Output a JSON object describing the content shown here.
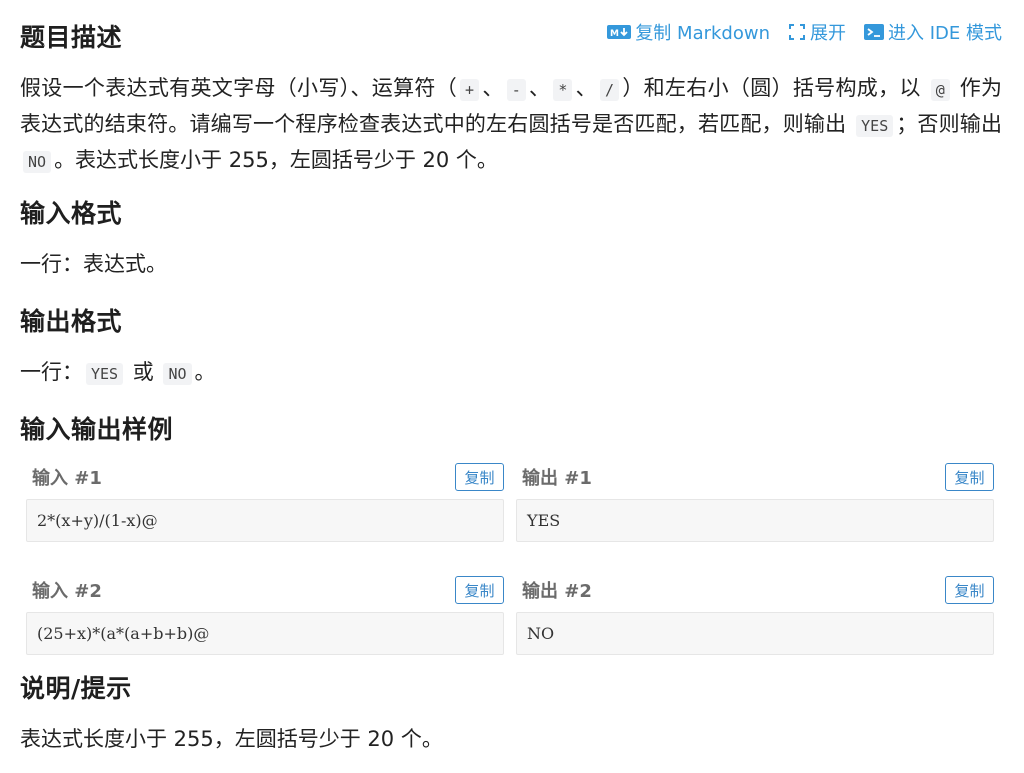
{
  "title": "题目描述",
  "toolbar": {
    "copy_markdown": "复制 Markdown",
    "expand": "展开",
    "ide_mode": "进入 IDE 模式"
  },
  "description": {
    "p1_a": "假设一个表达式有英文字母（小写）、运算符（",
    "op_plus": "+",
    "sep1": "、",
    "op_minus": "-",
    "sep2": "、",
    "op_mul": "*",
    "sep3": "、",
    "op_div": "/",
    "p1_b": "）和左右小（圆）括号构成，以",
    "at": "@",
    "p1_c": "作为表达式的结束符。请编写一个程序检查表达式中的左右圆括号是否匹配，若匹配，则输出",
    "yes": "YES",
    "p1_d": "；否则输出",
    "no": "NO",
    "p1_e": "。表达式长度小于 255，左圆括号少于 20 个。"
  },
  "input_format": {
    "heading": "输入格式",
    "text": "一行：表达式。"
  },
  "output_format": {
    "heading": "输出格式",
    "text_a": "一行：",
    "yes": "YES",
    "or": "或",
    "no": "NO",
    "end": "。"
  },
  "samples": {
    "heading": "输入输出样例",
    "copy_label": "复制",
    "items": [
      {
        "in_title": "输入 #1",
        "in": "2*(x+y)/(1-x)@",
        "out_title": "输出 #1",
        "out": "YES"
      },
      {
        "in_title": "输入 #2",
        "in": "(25+x)*(a*(a+b+b)@",
        "out_title": "输出 #2",
        "out": "NO"
      }
    ]
  },
  "hint": {
    "heading": "说明/提示",
    "text": "表达式长度小于 255，左圆括号少于 20 个。"
  },
  "colors": {
    "accent": "#3498db",
    "button_border": "#3a87c8"
  }
}
